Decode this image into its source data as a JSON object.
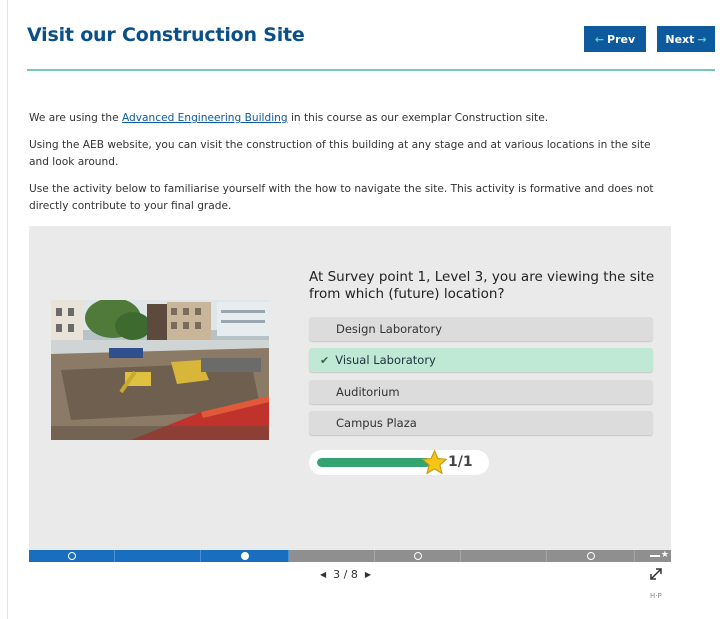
{
  "header": {
    "title": "Visit our Construction Site",
    "prev_label": "Prev",
    "next_label": "Next"
  },
  "intro": {
    "p1_before": "We are using the ",
    "p1_link": "Advanced Engineering Building",
    "p1_after": " in this course as our exemplar Construction site.",
    "p2": "Using the AEB website, you can visit the construction of this building at any stage and at various locations in the site and look around.",
    "p3": "Use the activity below to familiarise yourself with the how to navigate the site. This activity is formative and does not directly contribute to your final grade."
  },
  "activity": {
    "question": "At Survey point 1, Level 3, you are viewing the site from which (future) location?",
    "options": [
      {
        "label": "Design Laboratory",
        "correct": false
      },
      {
        "label": "Visual Laboratory",
        "correct": true
      },
      {
        "label": "Auditorium",
        "correct": false
      },
      {
        "label": "Campus Plaza",
        "correct": false
      }
    ],
    "score_text": "1/1",
    "score_fraction": 1.0
  },
  "progress": {
    "current_page": 3,
    "total_pages": 8,
    "pager_text": "3 / 8"
  },
  "footer": {
    "logo_text": "H·P"
  },
  "colors": {
    "title": "#0b4f8a",
    "nav_button": "#0d5a9e",
    "rule": "#76c6bf",
    "correct_option": "#bfe8d5",
    "score_fill": "#33a370",
    "progress_done": "#1a6ebf"
  }
}
